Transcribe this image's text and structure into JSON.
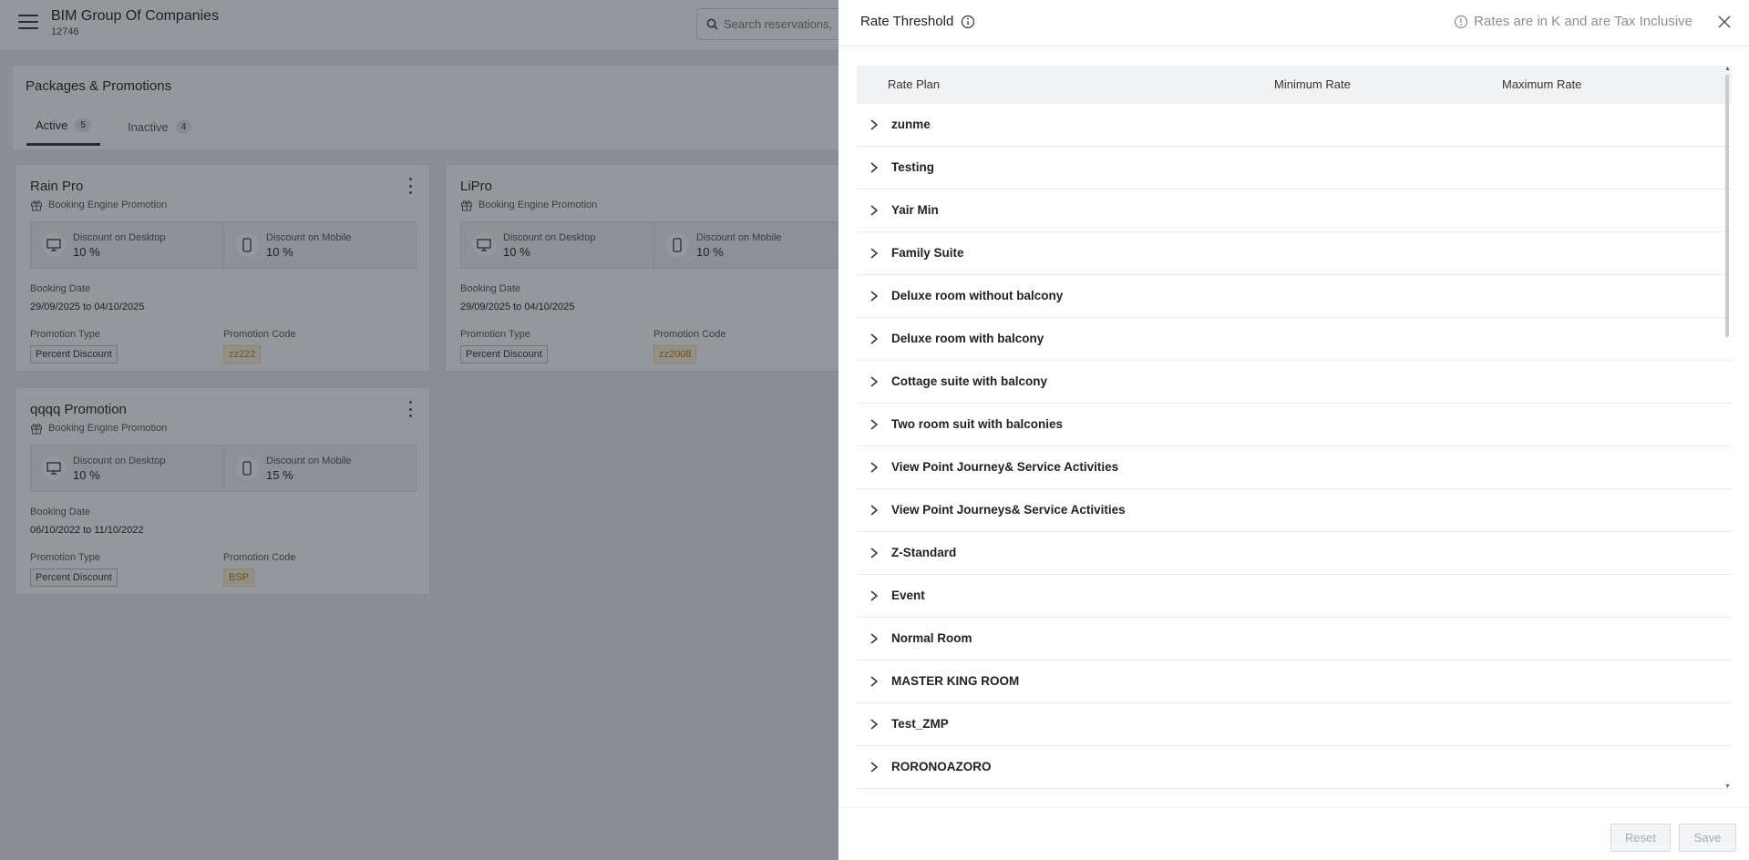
{
  "header": {
    "company_name": "BIM Group Of Companies",
    "company_id": "12746",
    "search_placeholder": "Search reservations,"
  },
  "section": {
    "title": "Packages & Promotions",
    "tabs": [
      {
        "label": "Active",
        "count": "5",
        "active": true
      },
      {
        "label": "Inactive",
        "count": "4",
        "active": false
      }
    ]
  },
  "cards": [
    {
      "title": "Rain Pro",
      "subtitle": "Booking Engine Promotion",
      "desktop_label": "Discount on Desktop",
      "desktop_value": "10 %",
      "mobile_label": "Discount on Mobile",
      "mobile_value": "10 %",
      "booking_label": "Booking Date",
      "booking_value": "29/09/2025 to 04/10/2025",
      "type_label": "Promotion Type",
      "type_value": "Percent Discount",
      "code_label": "Promotion Code",
      "code_value": "zz222"
    },
    {
      "title": "LiPro",
      "subtitle": "Booking Engine Promotion",
      "desktop_label": "Discount on Desktop",
      "desktop_value": "10 %",
      "mobile_label": "Discount on Mobile",
      "mobile_value": "10 %",
      "booking_label": "Booking Date",
      "booking_value": "29/09/2025 to 04/10/2025",
      "type_label": "Promotion Type",
      "type_value": "Percent Discount",
      "code_label": "Promotion Code",
      "code_value": "zz2008"
    },
    {
      "title": "qqqq Promotion",
      "subtitle": "Booking Engine Promotion",
      "desktop_label": "Discount on Desktop",
      "desktop_value": "10 %",
      "mobile_label": "Discount on Mobile",
      "mobile_value": "15 %",
      "booking_label": "Booking Date",
      "booking_value": "06/10/2022 to 11/10/2022",
      "type_label": "Promotion Type",
      "type_value": "Percent Discount",
      "code_label": "Promotion Code",
      "code_value": "BSP"
    }
  ],
  "drawer": {
    "title": "Rate Threshold",
    "note": "Rates are in K and are Tax Inclusive",
    "columns": {
      "rate_plan": "Rate Plan",
      "min_rate": "Minimum Rate",
      "max_rate": "Maximum Rate"
    },
    "rows": [
      "zunme",
      "Testing",
      "Yair Min",
      "Family Suite",
      "Deluxe room without balcony",
      "Deluxe room with balcony",
      "Cottage suite with balcony",
      "Two room suit with balconies",
      "View Point Journey& Service Activities",
      "View Point Journeys& Service Activities",
      "Z-Standard",
      "Event",
      "Normal Room",
      "MASTER KING ROOM",
      "Test_ZMP",
      "RORONOAZORO"
    ],
    "reset_label": "Reset",
    "save_label": "Save"
  },
  "colors": {
    "overlay": "#1c222a",
    "code_chip_text": "#b37d14",
    "code_chip_bg": "#fdf1d9",
    "note_text": "#8a8f96",
    "disabled_button_text": "#a5a9ae"
  },
  "icons": [
    "menu-icon",
    "search-icon",
    "gift-icon",
    "desktop-icon",
    "mobile-icon",
    "kebab-icon",
    "info-icon",
    "close-icon",
    "chevron-right-icon"
  ]
}
